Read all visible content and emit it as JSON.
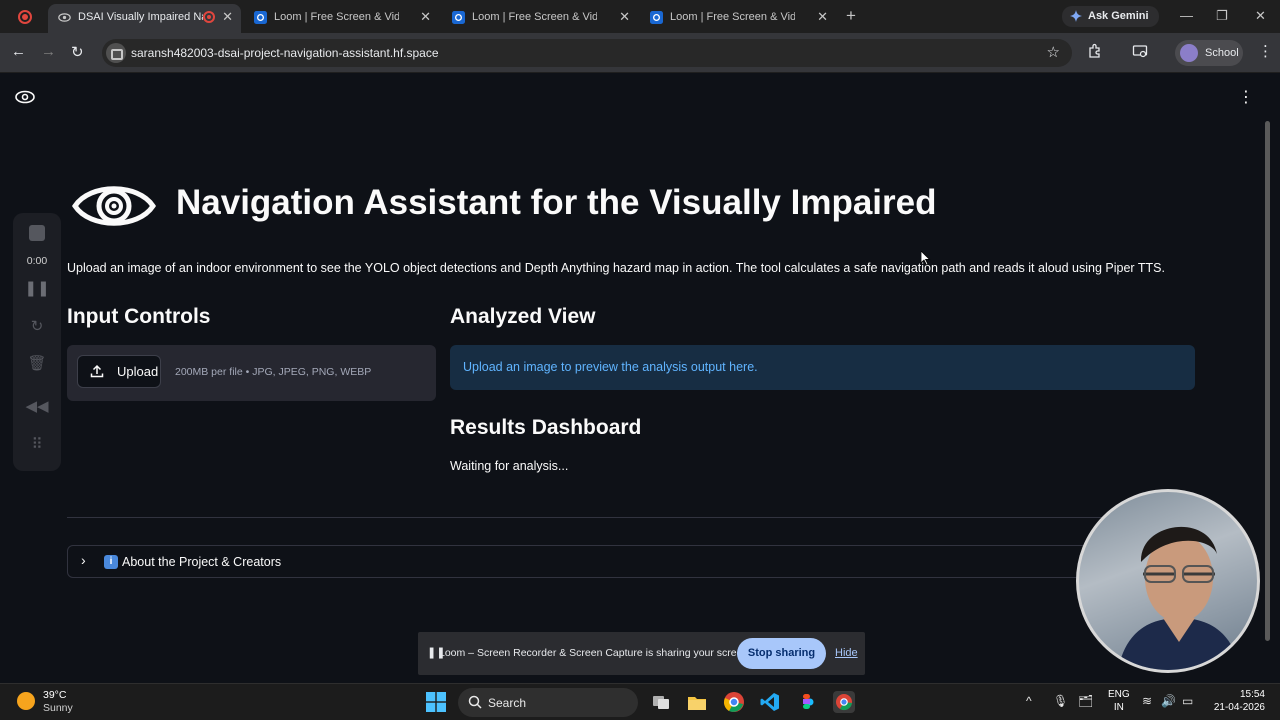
{
  "browser": {
    "tabs": [
      {
        "title": "DSAI Visually Impaired Navigation",
        "active": true
      },
      {
        "title": "Loom | Free Screen & Video Recording",
        "active": false
      },
      {
        "title": "Loom | Free Screen & Video Recording",
        "active": false
      },
      {
        "title": "Loom | Free Screen & Video Recording",
        "active": false
      }
    ],
    "gemini_label": "Ask Gemini",
    "url": "saransh482003-dsai-project-navigation-assistant.hf.space",
    "profile_label": "School"
  },
  "app": {
    "title": "Navigation Assistant for the Visually Impaired",
    "intro": "Upload an image of an indoor environment to see the YOLO object detections and Depth Anything hazard map in action. The tool calculates a safe navigation path and reads it aloud using Piper TTS.",
    "input_controls": {
      "heading": "Input Controls",
      "upload_label": "Upload",
      "upload_hint": "200MB per file • JPG, JPEG, PNG, WEBP"
    },
    "analyzed_view": {
      "heading": "Analyzed View",
      "info": "Upload an image to preview the analysis output here."
    },
    "results": {
      "heading": "Results Dashboard",
      "status": "Waiting for analysis..."
    },
    "expander": {
      "icon": "i",
      "label": "About the Project & Creators"
    }
  },
  "loom": {
    "timer": "0:00",
    "share_text": "Loom – Screen Recorder & Screen Capture is sharing your screen.",
    "stop_label": "Stop sharing",
    "hide_label": "Hide"
  },
  "taskbar": {
    "temperature": "39°C",
    "weather": "Sunny",
    "search_label": "Search",
    "lang_line1": "ENG",
    "lang_line2": "IN",
    "time": "15:54",
    "date": "21-04-2026"
  },
  "colors": {
    "page_bg": "#0e1117",
    "info_bg": "#172d43",
    "info_text": "#60b4ff",
    "stop_button": "#a8c7fa"
  }
}
